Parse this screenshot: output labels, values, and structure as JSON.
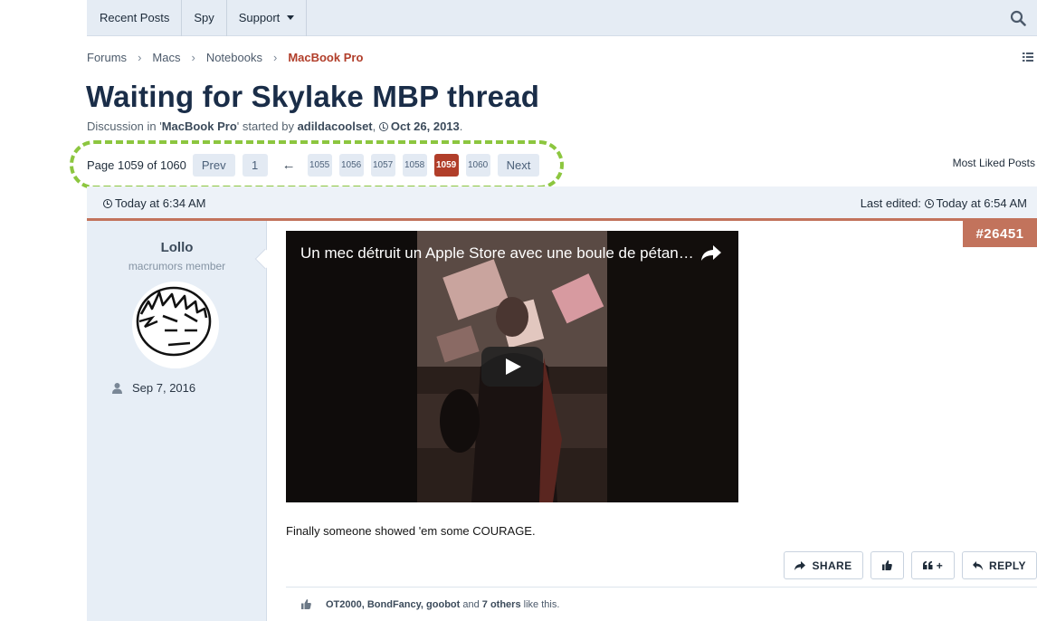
{
  "nav": {
    "items": [
      "Recent Posts",
      "Spy",
      "Support"
    ]
  },
  "breadcrumb": {
    "items": [
      "Forums",
      "Macs",
      "Notebooks"
    ],
    "current": "MacBook Pro"
  },
  "thread": {
    "title": "Waiting for Skylake MBP thread",
    "meta_prefix": "Discussion in '",
    "forum": "MacBook Pro",
    "meta_middle": "' started by ",
    "author": "adildacoolset",
    "date": "Oct 26, 2013",
    "meta_suffix": "."
  },
  "pagination": {
    "label": "Page 1059 of 1060",
    "prev": "Prev",
    "first": "1",
    "skip": "←",
    "pages": [
      "1055",
      "1056",
      "1057",
      "1058",
      "1059",
      "1060"
    ],
    "current_page": "1059",
    "next": "Next",
    "most_liked": "Most Liked Posts"
  },
  "post": {
    "time": "Today at 6:34 AM",
    "last_edited_label": "Last edited:",
    "last_edited_time": "Today at 6:54 AM",
    "number": "#26451",
    "user": {
      "name": "Lollo",
      "title": "macrumors member",
      "joined": "Sep 7, 2016"
    },
    "video_title": "Un mec détruit un Apple Store avec une boule de pétanque",
    "text": "Finally someone showed 'em some COURAGE.",
    "actions": {
      "share": "SHARE",
      "quote": "+",
      "reply": "REPLY"
    },
    "likes": {
      "users": "OT2000, BondFancy, goobot",
      "and": " and ",
      "others": "7 others",
      "suffix": " like this."
    }
  },
  "colors": {
    "accent": "#b13e2a",
    "post_accent": "#c2735c",
    "title": "#1a2d48",
    "nav_bg": "#e5ecf4",
    "highlight": "#8cc63f"
  }
}
